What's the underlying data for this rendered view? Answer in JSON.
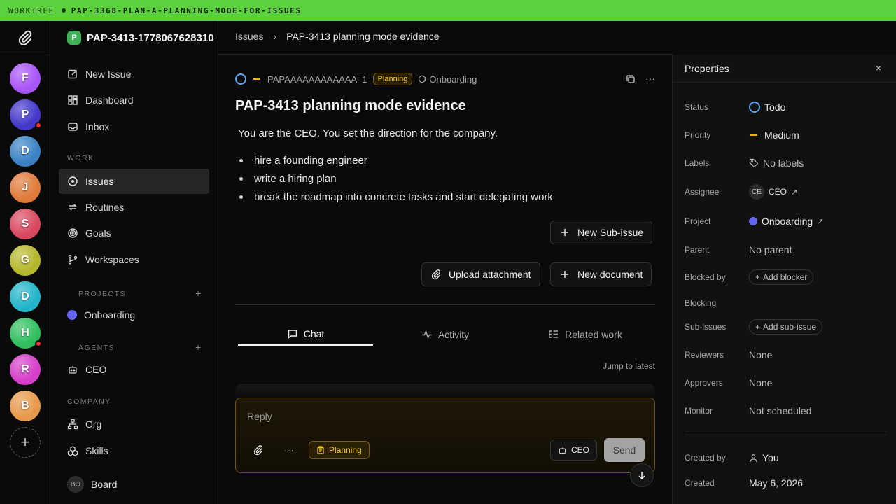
{
  "banner": {
    "label": "WORKTREE",
    "branch": "PAP-3368-PLAN-A-PLANNING-MODE-FOR-ISSUES"
  },
  "rail": {
    "avatars": [
      {
        "letter": "F",
        "color": "#a855f7",
        "alert": false
      },
      {
        "letter": "P",
        "color": "#4338ca",
        "alert": true
      },
      {
        "letter": "D",
        "color": "#3b82c4",
        "alert": false
      },
      {
        "letter": "J",
        "color": "#e07a3a",
        "alert": false
      },
      {
        "letter": "S",
        "color": "#d9485f",
        "alert": false
      },
      {
        "letter": "G",
        "color": "#b5b82c",
        "alert": false
      },
      {
        "letter": "D",
        "color": "#22b5c9",
        "alert": false
      },
      {
        "letter": "H",
        "color": "#2fbf5f",
        "alert": true
      },
      {
        "letter": "R",
        "color": "#d63fc9",
        "alert": false
      },
      {
        "letter": "B",
        "color": "#e89a4c",
        "alert": false
      }
    ],
    "add": "+"
  },
  "sidebar": {
    "workspace_initial": "P",
    "workspace_name": "PAP-3413-1778067628310",
    "top": [
      {
        "label": "New Issue"
      },
      {
        "label": "Dashboard"
      },
      {
        "label": "Inbox"
      }
    ],
    "work_section": "WORK",
    "work": [
      {
        "label": "Issues"
      },
      {
        "label": "Routines"
      },
      {
        "label": "Goals"
      },
      {
        "label": "Workspaces"
      }
    ],
    "projects_section": "PROJECTS",
    "projects": [
      {
        "label": "Onboarding"
      }
    ],
    "agents_section": "AGENTS",
    "agents": [
      {
        "label": "CEO"
      }
    ],
    "company_section": "COMPANY",
    "company": [
      {
        "label": "Org"
      },
      {
        "label": "Skills"
      }
    ],
    "board": {
      "initials": "BO",
      "label": "Board"
    }
  },
  "breadcrumb": {
    "parent": "Issues",
    "current": "PAP-3413 planning mode evidence"
  },
  "issue": {
    "identifier": "PAPAAAAAAAAAAAA–1",
    "mode_badge": "Planning",
    "project": "Onboarding",
    "title": "PAP-3413 planning mode evidence",
    "description": "You are the CEO. You set the direction for the company.",
    "bullets": [
      "hire a founding engineer",
      "write a hiring plan",
      "break the roadmap into concrete tasks and start delegating work"
    ],
    "buttons": {
      "new_subissue": "New Sub-issue",
      "upload": "Upload attachment",
      "new_document": "New document"
    }
  },
  "tabs": [
    {
      "label": "Chat"
    },
    {
      "label": "Activity"
    },
    {
      "label": "Related work"
    }
  ],
  "jump_label": "Jump to latest",
  "composer": {
    "placeholder": "Reply",
    "mode": "Planning",
    "agent": "CEO",
    "send": "Send"
  },
  "properties": {
    "title": "Properties",
    "status": {
      "key": "Status",
      "value": "Todo"
    },
    "priority": {
      "key": "Priority",
      "value": "Medium"
    },
    "labels": {
      "key": "Labels",
      "value": "No labels"
    },
    "assignee": {
      "key": "Assignee",
      "initials": "CE",
      "value": "CEO"
    },
    "project": {
      "key": "Project",
      "value": "Onboarding"
    },
    "parent": {
      "key": "Parent",
      "value": "No parent"
    },
    "blocked_by": {
      "key": "Blocked by",
      "value": "Add blocker"
    },
    "blocking": {
      "key": "Blocking"
    },
    "subissues": {
      "key": "Sub-issues",
      "value": "Add sub-issue"
    },
    "reviewers": {
      "key": "Reviewers",
      "value": "None"
    },
    "approvers": {
      "key": "Approvers",
      "value": "None"
    },
    "monitor": {
      "key": "Monitor",
      "value": "Not scheduled"
    },
    "created_by": {
      "key": "Created by",
      "value": "You"
    },
    "created": {
      "key": "Created",
      "value": "May 6, 2026"
    }
  },
  "colors": {
    "accent_green": "#5bd13d",
    "planning": "#facc15",
    "status_todo": "#60a5fa",
    "project": "#6366f1",
    "alert": "#ef3030"
  }
}
